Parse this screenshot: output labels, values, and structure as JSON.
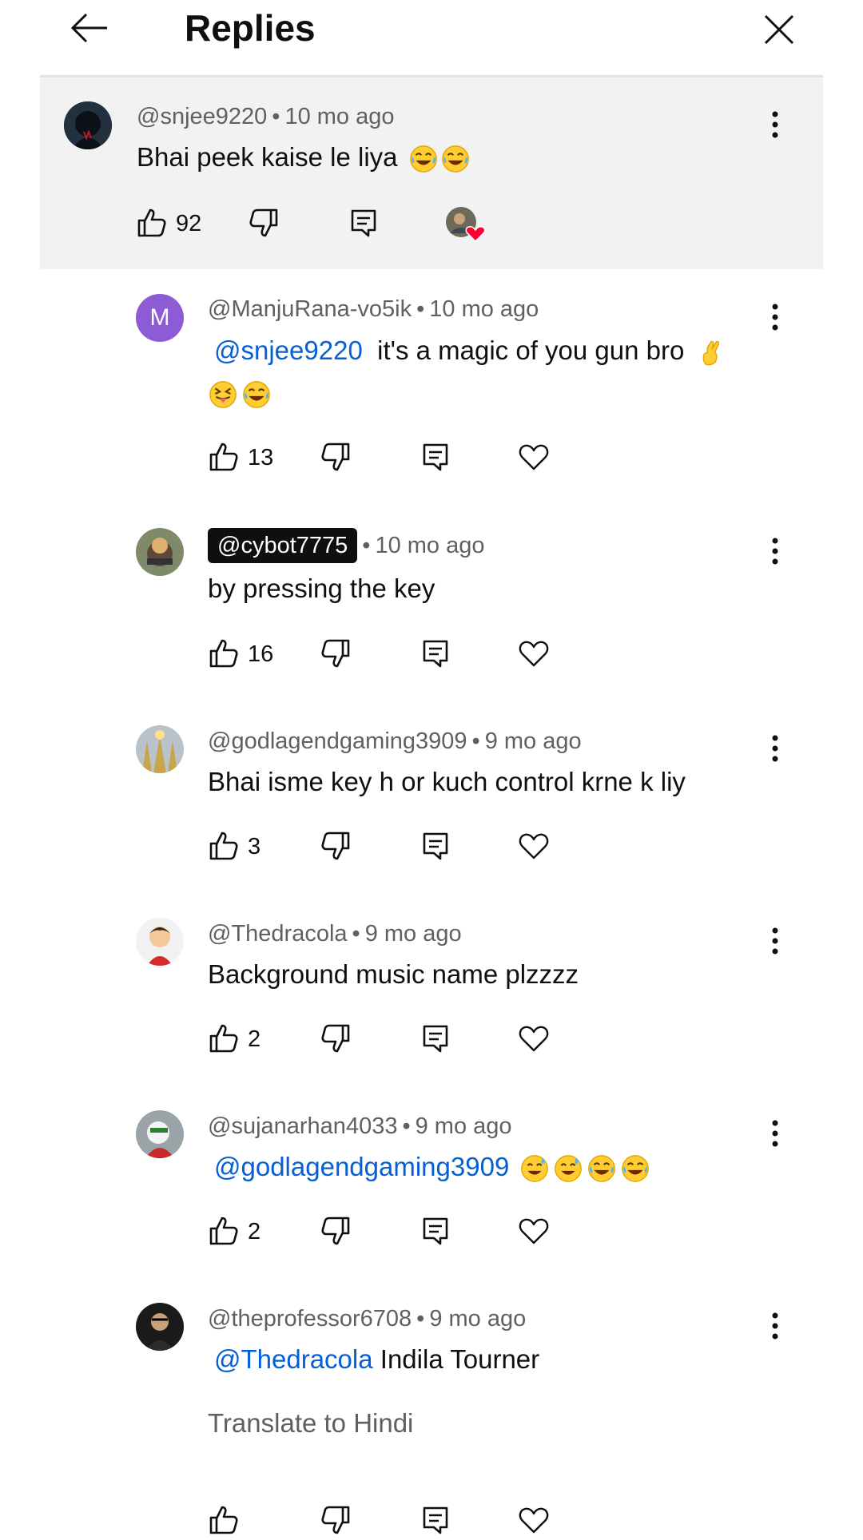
{
  "header": {
    "title": "Replies"
  },
  "parent": {
    "author": "@snjee9220",
    "age": "10 mo ago",
    "text": "Bhai peek kaise le liya",
    "likes": "92"
  },
  "replies": [
    {
      "author": "@ManjuRana-vo5ik",
      "age": "10 mo ago",
      "avatar_letter": "M",
      "mention": "@snjee9220",
      "text": "it's a magic of you gun bro",
      "likes": "13"
    },
    {
      "author": "@cybot7775",
      "age": "10 mo ago",
      "text": "by pressing the key",
      "likes": "16"
    },
    {
      "author": "@godlagendgaming3909",
      "age": "9 mo ago",
      "text": "Bhai isme key h or kuch control krne k liy",
      "likes": "3"
    },
    {
      "author": "@Thedracola",
      "age": "9 mo ago",
      "text": "Background music name plzzzz",
      "likes": "2"
    },
    {
      "author": "@sujanarhan4033",
      "age": "9 mo ago",
      "mention": "@godlagendgaming3909",
      "likes": "2"
    },
    {
      "author": "@theprofessor6708",
      "age": "9 mo ago",
      "mention": "@Thedracola",
      "text": "Indila Tourner",
      "translate": "Translate to Hindi"
    }
  ],
  "colors": {
    "mention": "#065fd4",
    "meta": "#606060",
    "parent_bg": "#f2f2f2",
    "heart": "#ff0033"
  },
  "icons": [
    "back-arrow-icon",
    "close-icon",
    "more-vert-icon",
    "like-icon",
    "dislike-icon",
    "reply-icon",
    "heart-icon"
  ]
}
